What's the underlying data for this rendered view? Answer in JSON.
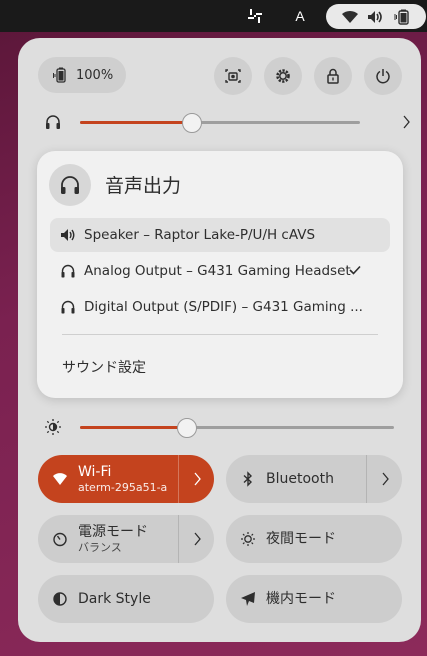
{
  "topbar": {
    "apps_icon": "apps-grid-icon",
    "input_method": "A",
    "status_icons": [
      "wifi-icon",
      "volume-icon",
      "battery-icon"
    ]
  },
  "quick_settings": {
    "battery": {
      "label": "100%",
      "icon": "battery-icon"
    },
    "buttons": [
      {
        "name": "screenshot-button",
        "icon": "camera-icon"
      },
      {
        "name": "settings-button",
        "icon": "gear-icon"
      },
      {
        "name": "lock-button",
        "icon": "lock-icon"
      },
      {
        "name": "power-button",
        "icon": "power-icon"
      }
    ],
    "volume": {
      "level": 0.4,
      "icon": "headphones-icon"
    },
    "brightness": {
      "level": 0.34,
      "icon": "brightness-icon"
    }
  },
  "sound_output": {
    "title": "音声出力",
    "items": [
      {
        "label": "Speaker – Raptor Lake-P/U/H cAVS",
        "icon": "speaker-icon",
        "checked": false,
        "highlighted": true
      },
      {
        "label": "Analog Output – G431 Gaming Headset",
        "icon": "headphones-icon",
        "checked": true,
        "highlighted": false
      },
      {
        "label": "Digital Output (S/PDIF) – G431 Gaming ...",
        "icon": "headphones-icon",
        "checked": false,
        "highlighted": false
      }
    ],
    "settings_label": "サウンド設定"
  },
  "toggles": {
    "wifi": {
      "label": "Wi-Fi",
      "sub": "aterm-295a51-a",
      "active": true
    },
    "bluetooth": {
      "label": "Bluetooth",
      "active": false
    },
    "power_mode": {
      "label": "電源モード",
      "sub": "バランス",
      "active": false
    },
    "night_mode": {
      "label": "夜間モード",
      "active": false
    },
    "dark_style": {
      "label": "Dark Style",
      "active": false
    },
    "airplane": {
      "label": "機内モード",
      "active": false
    }
  },
  "colors": {
    "accent": "#c4431e",
    "panel": "#dedede",
    "popover": "#f1f1f1"
  }
}
